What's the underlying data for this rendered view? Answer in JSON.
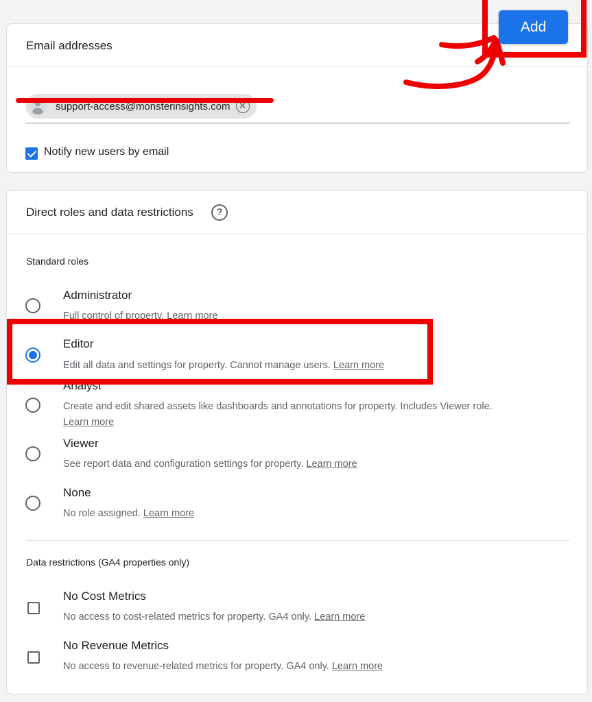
{
  "add_button": {
    "label": "Add"
  },
  "email_card": {
    "title": "Email addresses",
    "chip": {
      "email": "support-access@monsterinsights.com",
      "remove_glyph": "✕"
    },
    "notify": {
      "label": "Notify new users by email",
      "checked": true
    }
  },
  "roles_card": {
    "title": "Direct roles and data restrictions",
    "help_glyph": "?",
    "standard_roles_label": "Standard roles",
    "roles": [
      {
        "title": "Administrator",
        "desc": "Full control of property.",
        "link": "Learn more",
        "selected": false
      },
      {
        "title": "Editor",
        "desc": "Edit all data and settings for property. Cannot manage users.",
        "link": "Learn more",
        "selected": true
      },
      {
        "title": "Analyst",
        "desc": "Create and edit shared assets like dashboards and annotations for property. Includes Viewer role.",
        "link": "Learn more",
        "selected": false
      },
      {
        "title": "Viewer",
        "desc": "See report data and configuration settings for property.",
        "link": "Learn more",
        "selected": false
      },
      {
        "title": "None",
        "desc": "No role assigned.",
        "link": "Learn more",
        "selected": false
      }
    ],
    "data_restrictions_label": "Data restrictions (GA4 properties only)",
    "restrictions": [
      {
        "title": "No Cost Metrics",
        "desc": "No access to cost-related metrics for property. GA4 only.",
        "link": "Learn more",
        "checked": false
      },
      {
        "title": "No Revenue Metrics",
        "desc": "No access to revenue-related metrics for property. GA4 only.",
        "link": "Learn more",
        "checked": false
      }
    ]
  },
  "colors": {
    "accent": "#1a73e8",
    "annotation": "#ee0000",
    "background": "#f1f3f4"
  }
}
